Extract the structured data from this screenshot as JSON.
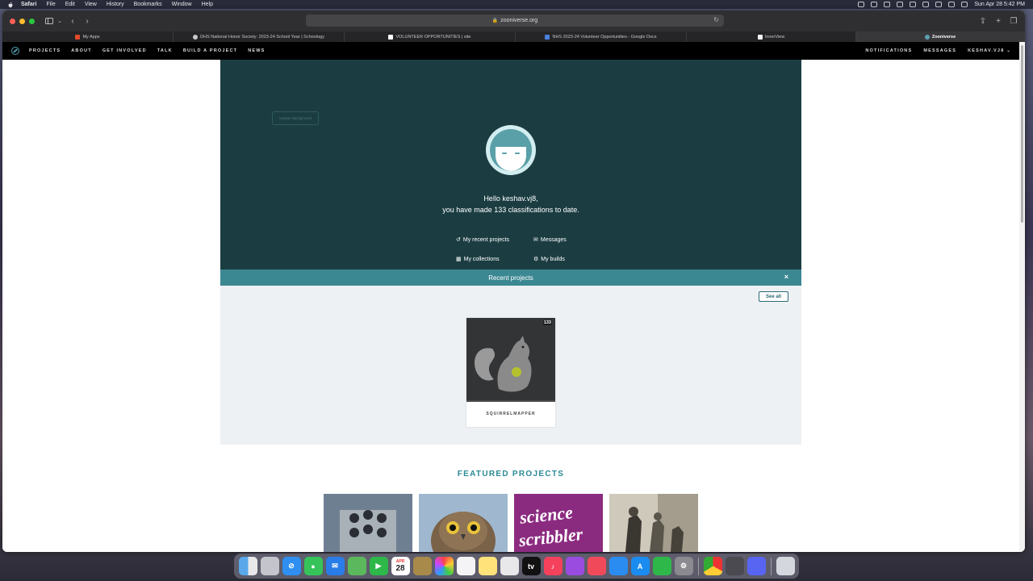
{
  "menubar": {
    "items": [
      "Safari",
      "File",
      "Edit",
      "View",
      "History",
      "Bookmarks",
      "Window",
      "Help"
    ],
    "datetime": "Sun Apr 28  5:42 PM"
  },
  "browser": {
    "url": "zooniverse.org",
    "tabs": [
      {
        "label": "My Apps",
        "color": "#e04a2a"
      },
      {
        "label": "DHS National Honor Society: 2023-24 School Year | Schoology",
        "color": "#c8c8c8"
      },
      {
        "label": "VOLUNTEER OPPORTUNITIES | site",
        "color": "#ffffff"
      },
      {
        "label": "NHS 2023-24 Volunteer Opportunities - Google Docs",
        "color": "#4a7fe0"
      },
      {
        "label": "InnerView",
        "color": "#f2f2f2"
      },
      {
        "label": "Zooniverse",
        "color": "#5aa0b0"
      }
    ]
  },
  "nav": {
    "items": [
      "PROJECTS",
      "ABOUT",
      "GET INVOLVED",
      "TALK",
      "BUILD A PROJECT",
      "NEWS"
    ],
    "right": [
      "NOTIFICATIONS",
      "MESSAGES",
      "KESHAV.VJ8"
    ],
    "user_caret": "⌄"
  },
  "hero": {
    "update_background": "Update Background",
    "hello_line1": "Hello keshav.vj8,",
    "hello_line2": "you have made 133 classifications to date.",
    "links": [
      {
        "label": "My recent projects",
        "icon": "history-icon",
        "glyph": "↺"
      },
      {
        "label": "Messages",
        "icon": "envelope-icon",
        "glyph": "✉"
      },
      {
        "label": "My collections",
        "icon": "grid-icon",
        "glyph": "▦"
      },
      {
        "label": "My builds",
        "icon": "gear-icon",
        "glyph": "⚙"
      }
    ]
  },
  "recent": {
    "title": "Recent projects",
    "close": "×",
    "see_all": "See all",
    "project": {
      "name": "SQUIRRELMAPPER",
      "count": "133"
    }
  },
  "featured": {
    "title": "FEATURED PROJECTS"
  },
  "dock": {
    "calendar_month": "APR",
    "calendar_day": "28"
  }
}
